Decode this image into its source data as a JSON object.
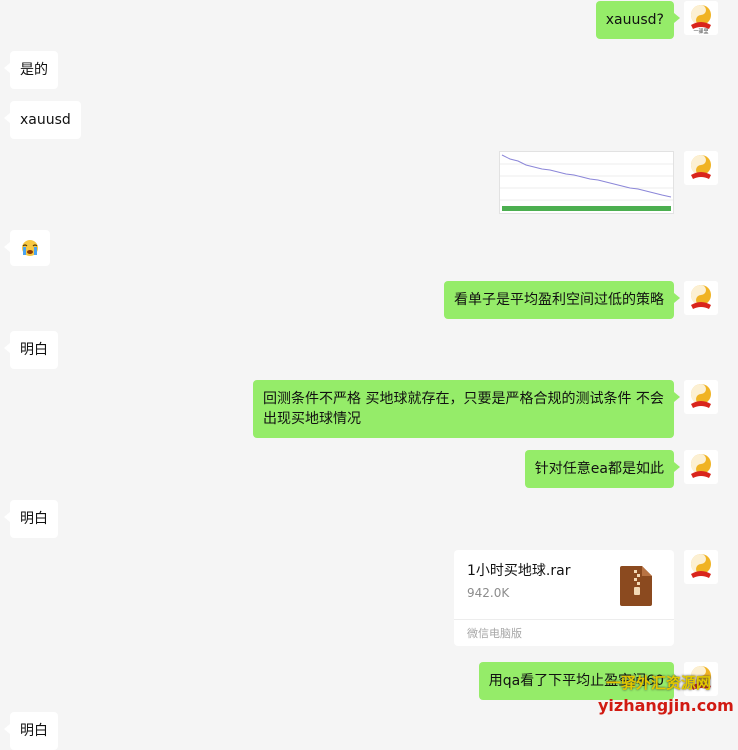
{
  "messages": [
    {
      "text": "xauusd?"
    },
    {
      "text": "是的"
    },
    {
      "text": "xauusd"
    },
    {
      "text": "看单子是平均盈利空间过低的策略"
    },
    {
      "text": "明白"
    },
    {
      "text": "回测条件不严格 买地球就存在，只要是严格合规的测试条件 不会出现买地球情况"
    },
    {
      "text": "针对任意ea都是如此"
    },
    {
      "text": "明白"
    },
    {
      "text": "用qa看了下平均止盈空间60"
    },
    {
      "text": "明白"
    }
  ],
  "file": {
    "name": "1小时买地球.rar",
    "size": "942.0K",
    "source": "微信电脑版"
  },
  "avatar": {
    "caption": "一驿里"
  },
  "watermark": {
    "line1": "一驿外汇资源网",
    "line2": "yizhangjin.com"
  },
  "colors": {
    "outgoing": "#95ec69",
    "incoming": "#ffffff",
    "background": "#f5f5f5"
  },
  "icons": [
    "avatar-logo-icon",
    "crying-face-icon",
    "zip-file-icon"
  ]
}
